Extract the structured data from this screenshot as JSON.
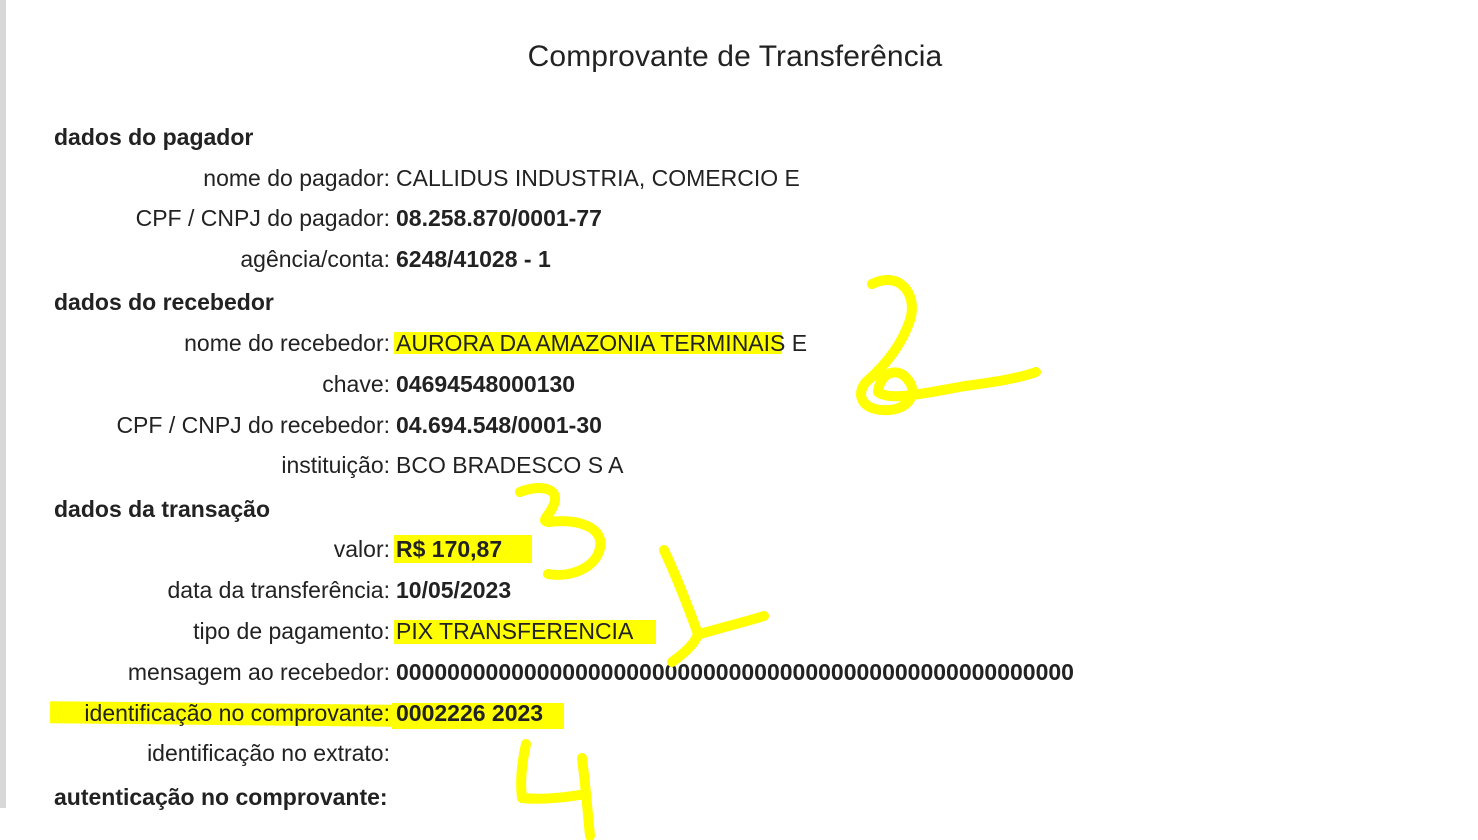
{
  "title": "Comprovante de Transferência",
  "sections": {
    "payer": "dados do pagador",
    "receiver": "dados do recebedor",
    "transaction": "dados da transação",
    "authentication": "autenticação no comprovante:"
  },
  "payer": {
    "name_label": "nome do pagador:",
    "name_value": "CALLIDUS INDUSTRIA, COMERCIO E",
    "doc_label": "CPF / CNPJ do pagador:",
    "doc_value": "08.258.870/0001-77",
    "account_label": "agência/conta:",
    "account_value": "6248/41028 - 1"
  },
  "receiver": {
    "name_label": "nome do recebedor:",
    "name_value": "AURORA DA AMAZONIA TERMINAIS E",
    "key_label": "chave:",
    "key_value": "04694548000130",
    "doc_label": "CPF / CNPJ do recebedor:",
    "doc_value": "04.694.548/0001-30",
    "institution_label": "instituição:",
    "institution_value": "BCO BRADESCO S A"
  },
  "transaction": {
    "amount_label": "valor:",
    "amount_value": "R$ 170,87",
    "date_label": "data da transferência:",
    "date_value": "10/05/2023",
    "type_label": "tipo de pagamento:",
    "type_value": "PIX TRANSFERENCIA",
    "message_label": "mensagem ao recebedor:",
    "message_value": "00000000000000000000000000000000000000000000000000000",
    "receipt_id_label": "identificação no comprovante:",
    "receipt_id_value": "0002226 2023",
    "statement_id_label": "identificação no extrato:"
  },
  "annotations": {
    "color": "#ffff00",
    "marks": [
      "1",
      "2",
      "3",
      "4"
    ]
  }
}
